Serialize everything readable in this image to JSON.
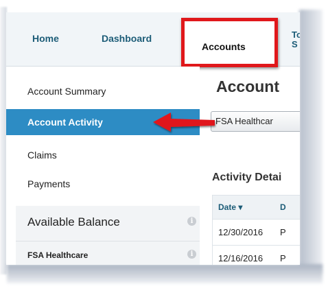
{
  "nav": {
    "tabs": [
      {
        "label": "Home"
      },
      {
        "label": "Dashboard"
      },
      {
        "label": "Accounts"
      }
    ],
    "cut_tab_line1": "To",
    "cut_tab_line2": "S"
  },
  "sidebar": {
    "items": [
      {
        "label": "Account Summary"
      },
      {
        "label": "Account Activity",
        "active": true
      },
      {
        "label": "Claims"
      },
      {
        "label": "Payments"
      }
    ],
    "balance": {
      "title": "Available Balance",
      "info_icon": "info-icon",
      "accounts": [
        {
          "label": "FSA Healthcare",
          "info_icon": "info-icon"
        }
      ]
    }
  },
  "main": {
    "title": "Account",
    "account_select": {
      "value": "FSA Healthcar"
    },
    "section_title": "Activity Detai",
    "table": {
      "columns": [
        {
          "label": "Date ▾"
        },
        {
          "label": "D"
        }
      ],
      "rows": [
        {
          "date": "12/30/2016",
          "desc": "P"
        },
        {
          "date": "12/16/2016",
          "desc": "P"
        }
      ]
    }
  },
  "colors": {
    "nav_link": "#1c5c77",
    "active_item_bg": "#2d8cc4",
    "annotation_red": "#e0181b"
  }
}
